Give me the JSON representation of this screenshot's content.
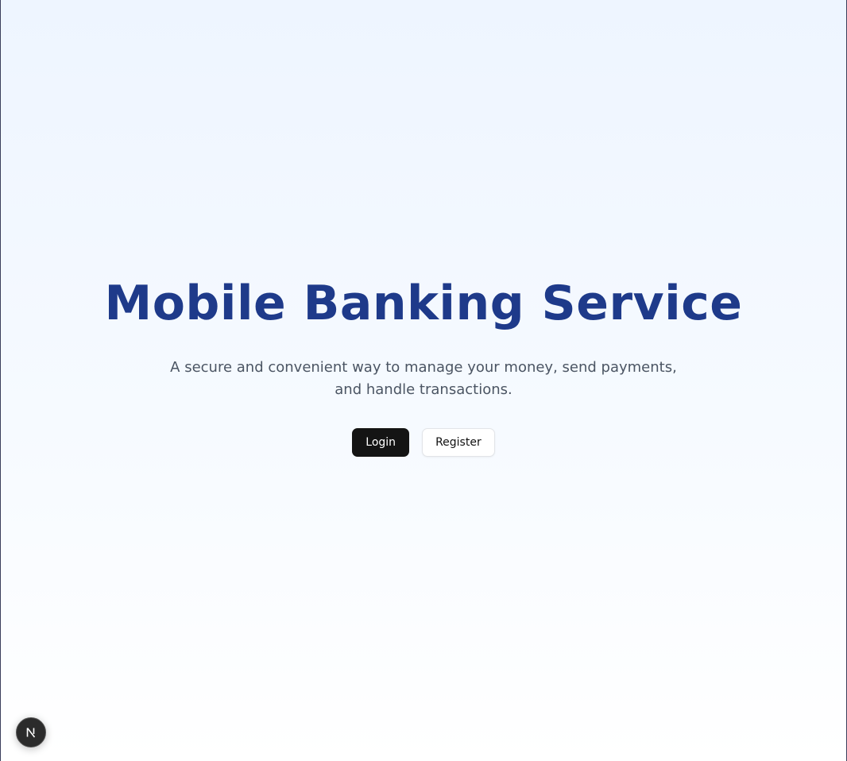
{
  "hero": {
    "title": "Mobile Banking Service",
    "subtitle": "A secure and convenient way to manage your money, send payments, and handle transactions."
  },
  "actions": {
    "login_label": "Login",
    "register_label": "Register"
  },
  "dev_indicator": {
    "icon": "nextjs-logo-icon"
  },
  "colors": {
    "title": "#1e3a8a",
    "subtitle": "#4b5563",
    "primary_button": "#141414",
    "background_top": "#eef5ff",
    "background_bottom": "#ffffff"
  }
}
